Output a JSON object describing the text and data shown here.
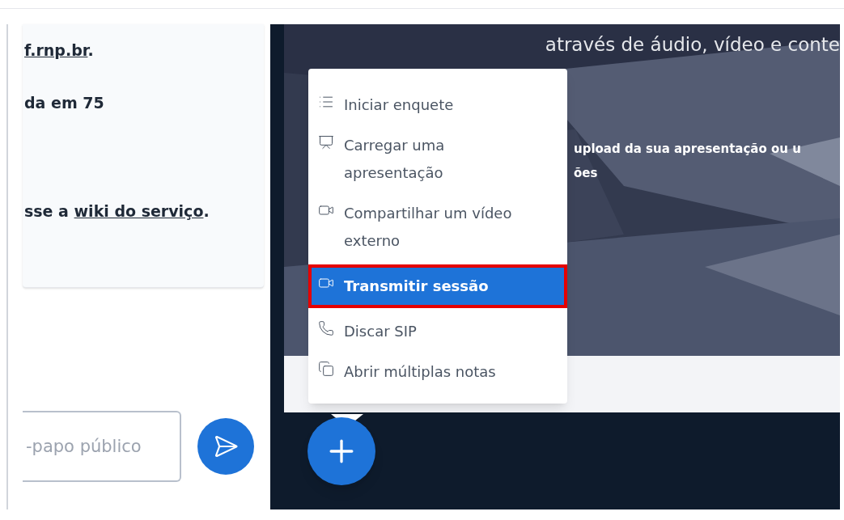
{
  "chat": {
    "message": [
      {
        "parts": [
          {
            "text": "f.rnp.br",
            "link": true
          },
          {
            "text": ".",
            "link": false
          }
        ]
      },
      {
        "parts": [
          {
            "text": "da em 75",
            "link": false
          }
        ]
      },
      {
        "parts": [
          {
            "text": "sse a ",
            "link": false
          },
          {
            "text": "wiki do serviço",
            "link": true
          },
          {
            "text": ".",
            "link": false
          }
        ]
      }
    ],
    "input": {
      "placeholder": "-papo público"
    }
  },
  "slide": {
    "heading": "através de áudio, vídeo e conte",
    "body": [
      "upload da sua apresentação ou u",
      "ões"
    ]
  },
  "actions_menu": {
    "items": [
      {
        "kind": "list",
        "label": "Iniciar enquete",
        "selected": false,
        "outlined": false
      },
      {
        "kind": "easel",
        "label": "Carregar uma apresentação",
        "selected": false,
        "outlined": false
      },
      {
        "kind": "camera",
        "label": "Compartilhar um vídeo externo",
        "selected": false,
        "outlined": false
      },
      {
        "kind": "camera",
        "label": "Transmitir sessão",
        "selected": true,
        "outlined": true
      },
      {
        "kind": "phone",
        "label": "Discar SIP",
        "selected": false,
        "outlined": false
      },
      {
        "kind": "copy",
        "label": "Abrir múltiplas notas",
        "selected": false,
        "outlined": false
      }
    ]
  }
}
